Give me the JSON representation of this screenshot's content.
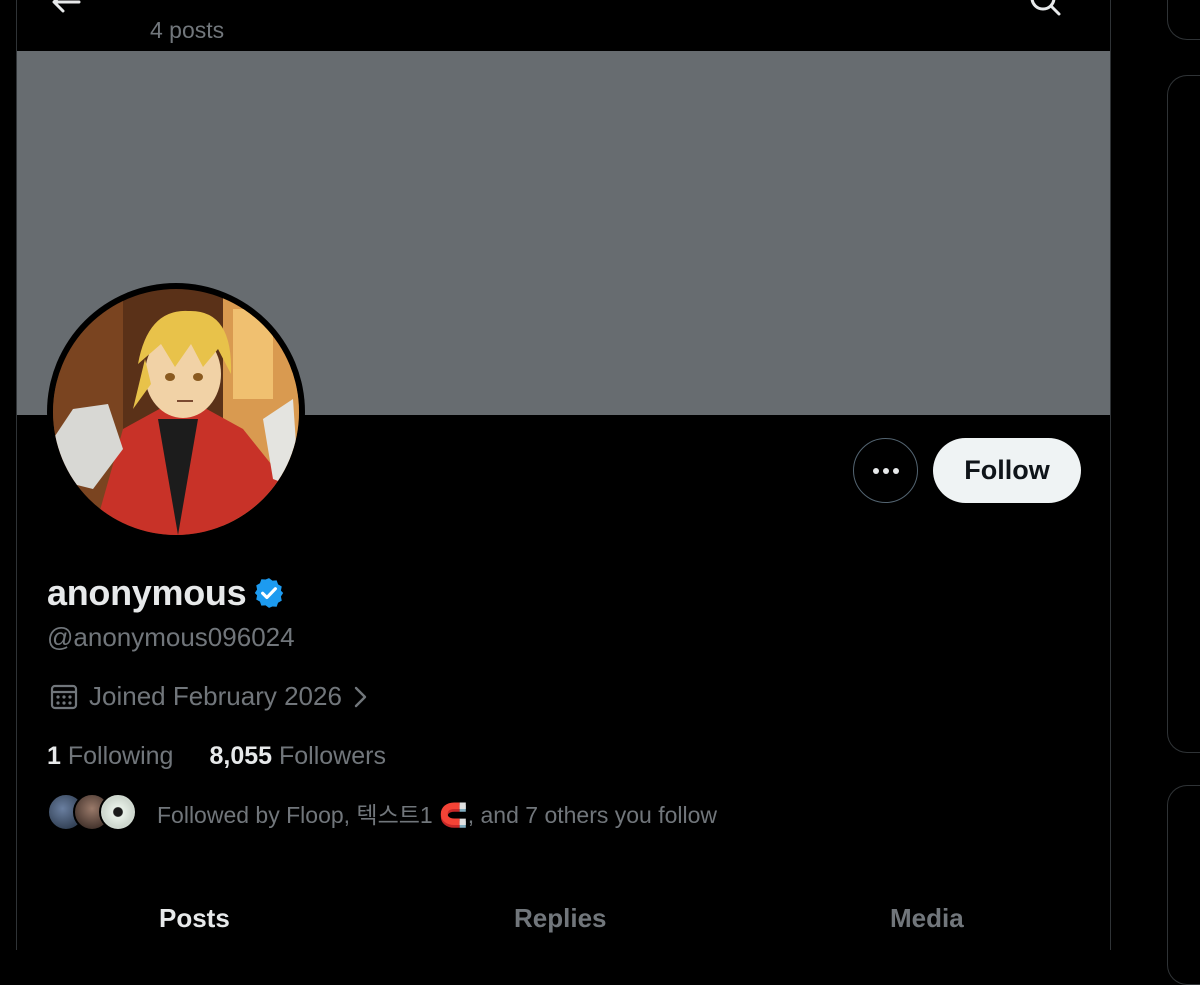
{
  "header": {
    "post_count": "4 posts"
  },
  "profile": {
    "display_name": "anonymous",
    "handle": "@anonymous096024",
    "joined": "Joined February 2026",
    "follow_label": "Follow",
    "following_count": "1",
    "following_label": "Following",
    "followers_count": "8,055",
    "followers_label": "Followers",
    "followed_by_text": "Followed by Floop, 텍스트1 🧲, and 7 others you follow"
  },
  "tabs": [
    {
      "label": "Posts",
      "active": true
    },
    {
      "label": "Replies",
      "active": false
    },
    {
      "label": "Media",
      "active": false
    }
  ],
  "colors": {
    "background": "#000000",
    "banner": "#676c70",
    "verified": "#1d9bf0",
    "secondary_text": "#71767b",
    "follow_button_bg": "#eff3f4"
  },
  "icons": [
    "back-arrow-icon",
    "search-icon",
    "more-icon",
    "verified-icon",
    "calendar-icon",
    "chevron-right-icon"
  ]
}
